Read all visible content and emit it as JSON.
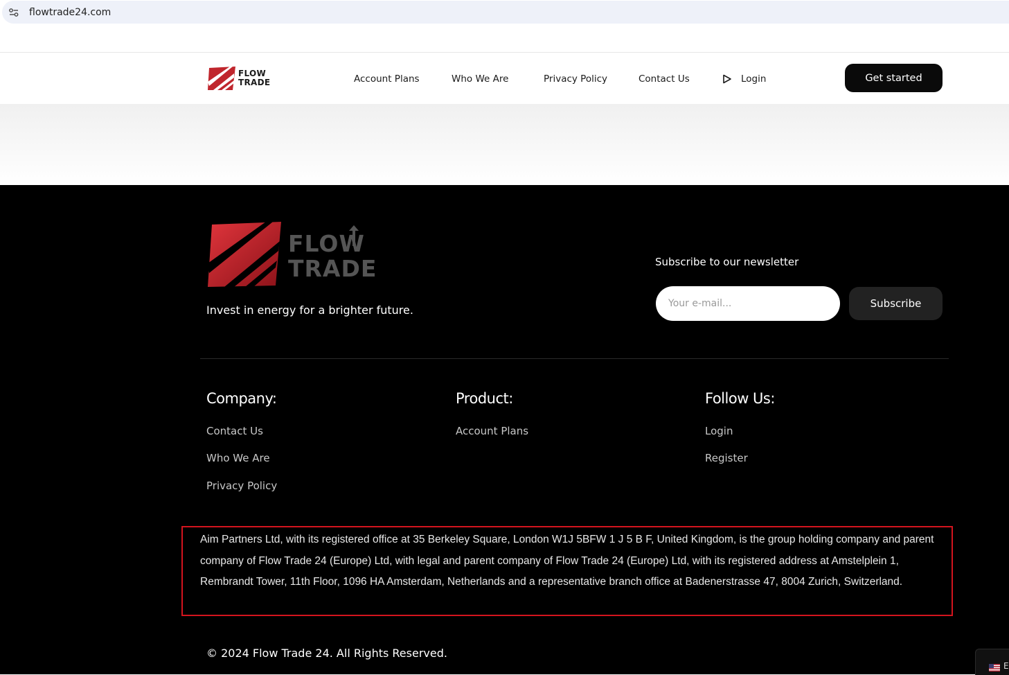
{
  "browser": {
    "url": "flowtrade24.com"
  },
  "header": {
    "logo_text_line1": "FLOW",
    "logo_text_line2": "TRADE",
    "nav": [
      "Account Plans",
      "Who We Are",
      "Privacy Policy",
      "Contact Us"
    ],
    "login_label": "Login",
    "cta_label": "Get started"
  },
  "footer": {
    "logo_text_line1": "FLOW",
    "logo_text_line2": "TRADE",
    "tagline": "Invest in energy for a brighter future.",
    "newsletter": {
      "title": "Subscribe to our newsletter",
      "placeholder": "Your e-mail...",
      "button_label": "Subscribe"
    },
    "columns": [
      {
        "heading": "Company:",
        "links": [
          "Contact Us",
          "Who We Are",
          "Privacy Policy"
        ]
      },
      {
        "heading": "Product:",
        "links": [
          "Account Plans"
        ]
      },
      {
        "heading": "Follow Us:",
        "links": [
          "Login",
          "Register"
        ]
      }
    ],
    "legal": "Aim Partners Ltd, with its registered office at 35 Berkeley Square, London W1J 5BFW 1 J 5 B F, United Kingdom, is the group holding company and parent company of Flow Trade 24 (Europe) Ltd, with legal and parent company of Flow Trade 24 (Europe) Ltd, with its registered address at Amstelplein 1, Rembrandt Tower, 11th Floor, 1096 HA Amsterdam, Netherlands and a representative branch office at Badenerstrasse 47, 8004 Zurich, Switzerland.",
    "copyright": "© 2024 Flow Trade 24. All Rights Reserved."
  },
  "language_widget": {
    "label": "E"
  },
  "colors": {
    "brand_red": "#c0262d",
    "legal_highlight": "#d4141e"
  }
}
